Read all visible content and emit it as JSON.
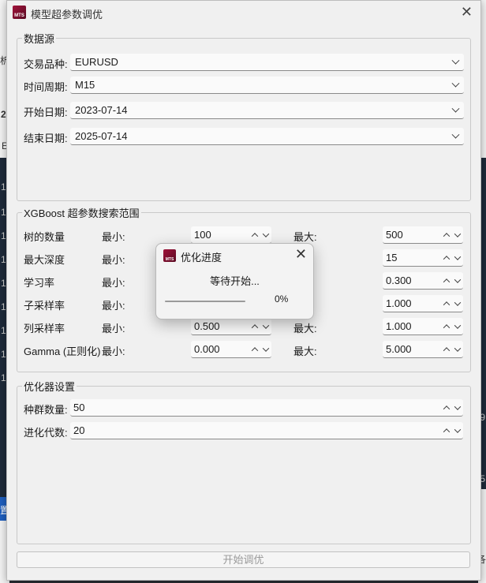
{
  "window": {
    "title": "模型超参数调优",
    "app_icon_text": "MTS"
  },
  "data_source": {
    "legend": "数据源",
    "rows": [
      {
        "label": "交易品种:",
        "value": "EURUSD"
      },
      {
        "label": "时间周期:",
        "value": "M15"
      },
      {
        "label": "开始日期:",
        "value": "2023-07-14"
      },
      {
        "label": "结束日期:",
        "value": "2025-07-14"
      }
    ]
  },
  "xgb": {
    "legend": "XGBoost 超参数搜索范围",
    "min_label": "最小:",
    "max_label": "最大:",
    "rows": [
      {
        "label": "树的数量",
        "min": "100",
        "max": "500"
      },
      {
        "label": "最大深度",
        "min": "",
        "max": "15"
      },
      {
        "label": "学习率",
        "min": "",
        "max": "0.300"
      },
      {
        "label": "子采样率",
        "min": "",
        "max": "1.000"
      },
      {
        "label": "列采样率",
        "min": "0.500",
        "max": "1.000"
      },
      {
        "label": "Gamma (正则化)",
        "min": "0.000",
        "max": "5.000"
      }
    ]
  },
  "optimizer": {
    "legend": "优化器设置",
    "rows": [
      {
        "label": "种群数量:",
        "value": "50"
      },
      {
        "label": "进化代数:",
        "value": "20"
      }
    ]
  },
  "start_button": "开始调优",
  "progress": {
    "title": "优化进度",
    "status": "等待开始...",
    "percent_text": "0%",
    "percent": 0
  },
  "background": {
    "glyphs": [
      "析",
      "2",
      "E",
      "1",
      "1",
      "1",
      "1",
      "1",
      "1",
      "1",
      "1",
      "1",
      "置",
      "9",
      "5",
      "各"
    ]
  },
  "colors": {
    "accent": "#1f5fbf",
    "icon": "#a0133a"
  }
}
